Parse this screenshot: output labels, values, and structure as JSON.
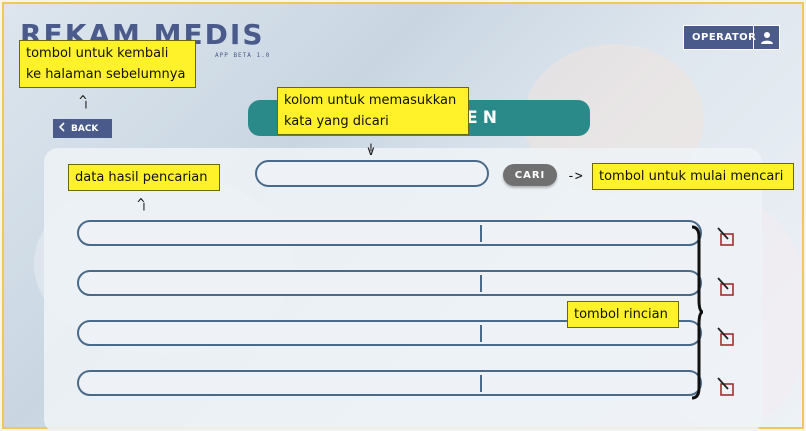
{
  "header": {
    "app_title": "REKAM MEDIS",
    "app_version": "APP BETA 1.0",
    "operator_label": "OPERATOR",
    "operator_icon": "user-icon"
  },
  "nav": {
    "back_label": "BACK",
    "back_icon": "chevron-left-icon"
  },
  "page": {
    "title_visible_fragment": "EN"
  },
  "search": {
    "input_value": "",
    "button_label": "CARI"
  },
  "results": {
    "rows": [
      {
        "col1": "",
        "col2": ""
      },
      {
        "col1": "",
        "col2": ""
      },
      {
        "col1": "",
        "col2": ""
      },
      {
        "col1": "",
        "col2": ""
      }
    ],
    "detail_icon": "open-detail-icon"
  },
  "annotations": {
    "back": "tombol untuk kembali ke halaman sebelumnya",
    "back_line1": "tombol untuk kembali",
    "back_line2": "ke halaman sebelumnya",
    "search_input_line1": "kolom untuk memasukkan",
    "search_input_line2": "kata yang dicari",
    "results": "data hasil pencarian",
    "search_button": "tombol untuk mulai mencari",
    "detail": "tombol rincian",
    "arrow_up": "^",
    "arrow_down": "v",
    "arrow_right": "->"
  },
  "colors": {
    "brand": "#4a5a8a",
    "title_banner": "#2a8a8a",
    "annotation": "#fff22a",
    "button_gray": "#707070",
    "outline": "#4a6a8a"
  }
}
